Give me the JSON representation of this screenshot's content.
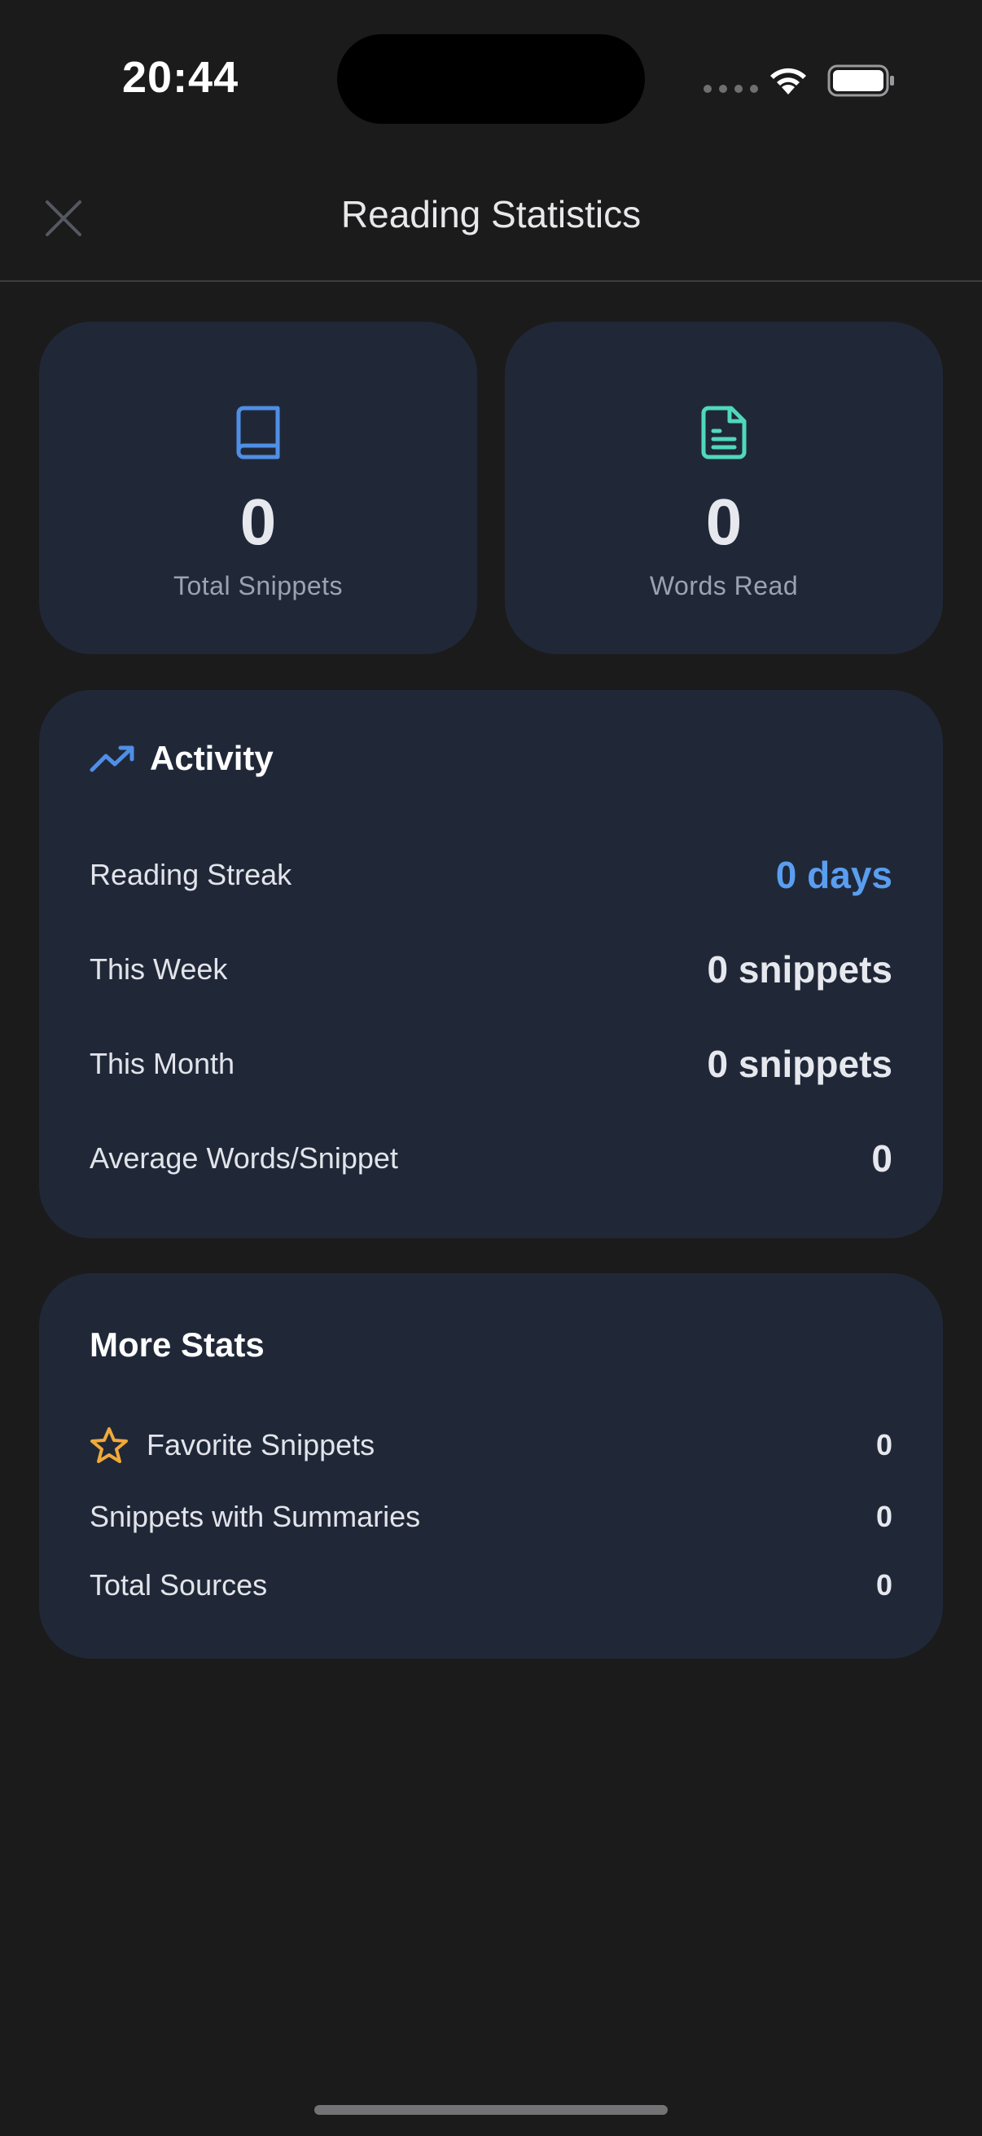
{
  "status_bar": {
    "time": "20:44"
  },
  "nav": {
    "title": "Reading Statistics"
  },
  "stats": {
    "total_snippets": {
      "value": "0",
      "label": "Total Snippets"
    },
    "words_read": {
      "value": "0",
      "label": "Words Read"
    }
  },
  "activity": {
    "title": "Activity",
    "rows": [
      {
        "label": "Reading Streak",
        "value": "0 days"
      },
      {
        "label": "This Week",
        "value": "0 snippets"
      },
      {
        "label": "This Month",
        "value": "0 snippets"
      },
      {
        "label": "Average Words/Snippet",
        "value": "0"
      }
    ]
  },
  "more_stats": {
    "title": "More Stats",
    "rows": [
      {
        "label": "Favorite Snippets",
        "value": "0"
      },
      {
        "label": "Snippets with Summaries",
        "value": "0"
      },
      {
        "label": "Total Sources",
        "value": "0"
      }
    ]
  },
  "colors": {
    "background": "#1b1b1c",
    "card": "#202838",
    "accent_blue": "#5a9ef0",
    "accent_teal": "#4fd8bd",
    "star_orange": "#f0a93a"
  },
  "icons": {
    "close": "close-icon",
    "book": "book-icon",
    "document": "document-icon",
    "trend": "trending-up-icon",
    "star": "star-icon"
  }
}
